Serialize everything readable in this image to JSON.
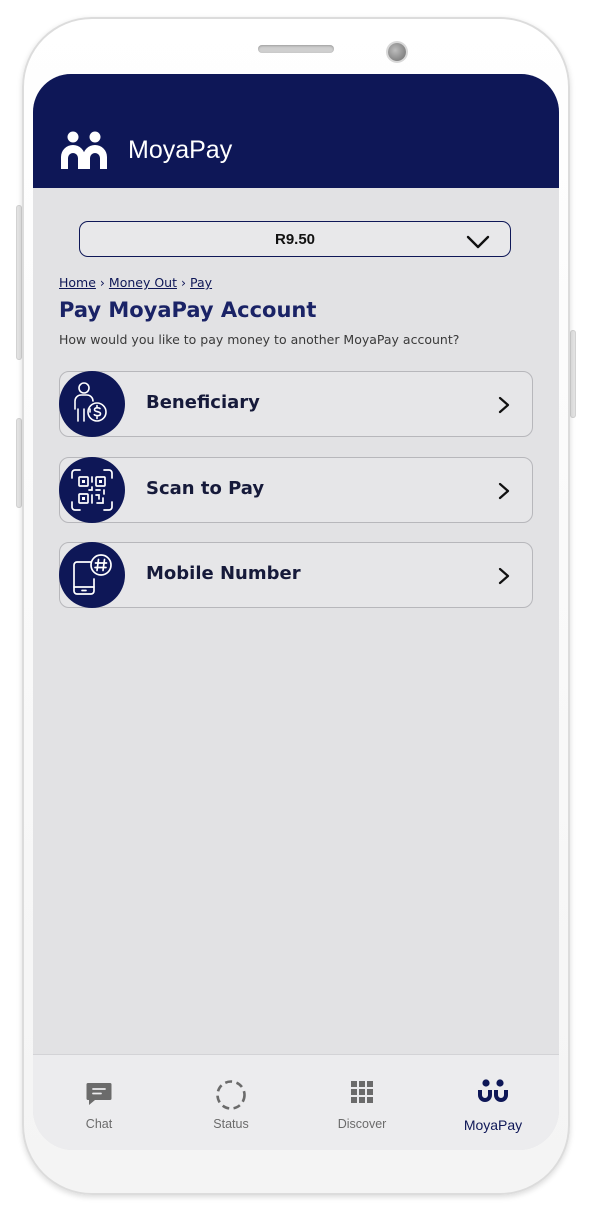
{
  "app": {
    "title": "MoyaPay"
  },
  "balance": {
    "value": "R9.50"
  },
  "breadcrumb": [
    {
      "label": "Home"
    },
    {
      "label": "Money Out"
    },
    {
      "label": "Pay"
    }
  ],
  "page": {
    "title": "Pay MoyaPay Account",
    "subtitle": "How would you like to pay money to another MoyaPay account?"
  },
  "options": [
    {
      "label": "Beneficiary",
      "icon": "beneficiary-icon"
    },
    {
      "label": "Scan to Pay",
      "icon": "qr-scan-icon"
    },
    {
      "label": "Mobile Number",
      "icon": "mobile-number-icon"
    }
  ],
  "nav": [
    {
      "label": "Chat",
      "icon": "chat-icon",
      "active": false
    },
    {
      "label": "Status",
      "icon": "status-icon",
      "active": false
    },
    {
      "label": "Discover",
      "icon": "grid-icon",
      "active": false
    },
    {
      "label": "MoyaPay",
      "icon": "moyapay-icon",
      "active": true
    }
  ],
  "colors": {
    "brand": "#0e1757",
    "background": "#e2e2e4",
    "nav_inactive": "#6b6b6b"
  }
}
